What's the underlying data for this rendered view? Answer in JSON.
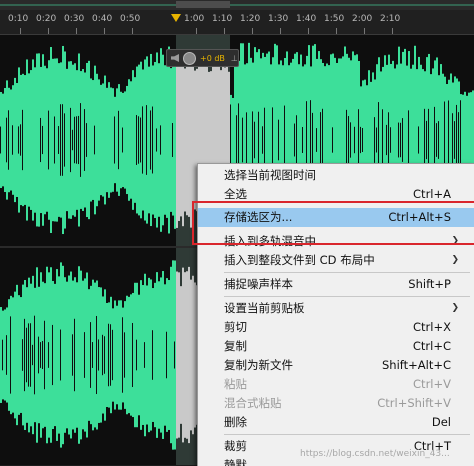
{
  "ruler": {
    "ticks": [
      "0:10",
      "0:20",
      "0:30",
      "0:40",
      "0:50",
      "1:00",
      "1:10",
      "1:20",
      "1:30",
      "1:40",
      "1:50",
      "2:00",
      "2:10"
    ]
  },
  "hud": {
    "gain_text": "+0 dB"
  },
  "colors": {
    "waveform": "#3ddf9a",
    "waveform_selected": "#c9c9c9",
    "menu_highlight": "#99c9ef",
    "annotation_box": "#d9262c",
    "playhead": "#e8b400"
  },
  "context_menu": {
    "items": [
      {
        "label": "选择当前视图时间",
        "shortcut": ""
      },
      {
        "label": "全选",
        "shortcut": "Ctrl+A"
      },
      {
        "label": "存储选区为...",
        "shortcut": "Ctrl+Alt+S",
        "highlighted": true
      },
      {
        "label": "插入到多轨混音中",
        "shortcut": "",
        "submenu": true
      },
      {
        "label": "插入到整段文件到 CD 布局中",
        "shortcut": "",
        "submenu": true
      },
      {
        "label": "捕捉噪声样本",
        "shortcut": "Shift+P"
      },
      {
        "label": "设置当前剪贴板",
        "shortcut": "",
        "submenu": true
      },
      {
        "label": "剪切",
        "shortcut": "Ctrl+X"
      },
      {
        "label": "复制",
        "shortcut": "Ctrl+C"
      },
      {
        "label": "复制为新文件",
        "shortcut": "Shift+Alt+C"
      },
      {
        "label": "粘贴",
        "shortcut": "Ctrl+V",
        "disabled": true
      },
      {
        "label": "混合式粘贴",
        "shortcut": "Ctrl+Shift+V",
        "disabled": true
      },
      {
        "label": "删除",
        "shortcut": "Del"
      },
      {
        "label": "裁剪",
        "shortcut": "Ctrl+T"
      },
      {
        "label": "静默",
        "shortcut": ""
      }
    ]
  },
  "watermark": "https://blog.csdn.net/weixin_43..."
}
